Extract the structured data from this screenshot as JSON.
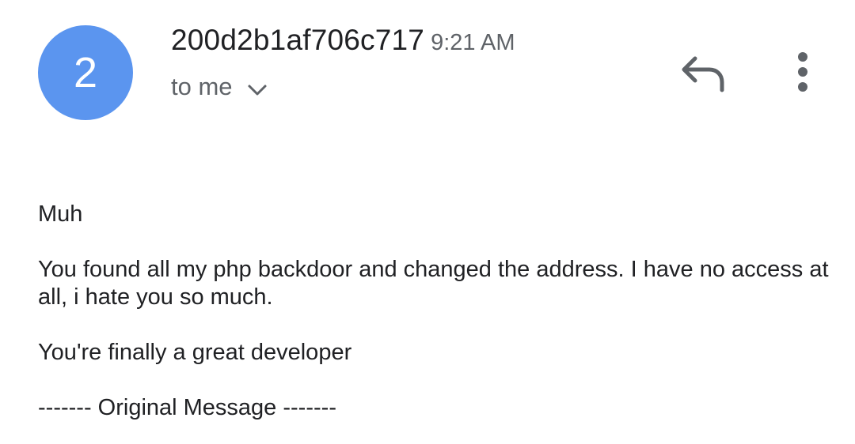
{
  "message": {
    "avatar_initial": "2",
    "sender": "200d2b1af706c717",
    "time": "9:21 AM",
    "recipients": "to me",
    "body": {
      "greeting": "Muh",
      "paragraph_1": "You found all my php backdoor and changed the address. I have no access at all, i hate you so much.",
      "paragraph_2": "You're finally a great developer",
      "original_divider": "------- Original Message -------"
    }
  },
  "icons": {
    "recipients_expand": "chevron-down-icon",
    "reply": "reply-icon",
    "more": "more-vertical-icon"
  },
  "colors": {
    "avatar_bg": "#5b95ef",
    "text_primary": "#202124",
    "text_secondary": "#5f6368"
  }
}
